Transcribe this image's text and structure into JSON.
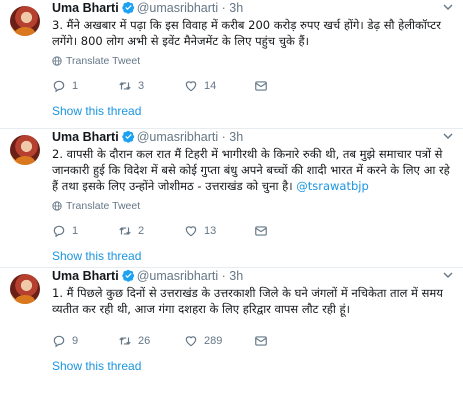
{
  "tweets": [
    {
      "name": "Uma Bharti",
      "handle": "@umasribharti",
      "dot": "·",
      "time": "3h",
      "text": "3. मैंने अखबार में पढ़ा कि इस विवाह में करीब 200 करोड़ रुपए खर्च होंगे। डेढ़ सौ हेलीकॉप्टर लगेंगे। 800 लोग अभी से इवेंट मैनेजमेंट के लिए पहुंच चुके हैं।",
      "mention": "",
      "translate": "Translate Tweet",
      "replies": "1",
      "retweets": "3",
      "likes": "14",
      "show_thread": "Show this thread"
    },
    {
      "name": "Uma Bharti",
      "handle": "@umasribharti",
      "dot": "·",
      "time": "3h",
      "text": "2. वापसी के दौरान कल रात मैं टिहरी में भागीरथी के किनारे रुकी थी, तब मुझे समाचार पत्रों से जानकारी हुई कि विदेश में बसे कोई गुप्ता बंधु अपने बच्चों की शादी भारत में करने के लिए आ रहे हैं तथा इसके लिए उन्होंने जोशीमठ - उत्तराखंड को चुना है।",
      "mention": "@tsrawatbjp",
      "translate": "Translate Tweet",
      "replies": "1",
      "retweets": "2",
      "likes": "13",
      "show_thread": "Show this thread"
    },
    {
      "name": "Uma Bharti",
      "handle": "@umasribharti",
      "dot": "·",
      "time": "3h",
      "text": "1. मैं पिछले कुछ दिनों से उत्तराखंड के उत्तरकाशी जिले के घने जंगलों में नचिकेता ताल में समय व्यतीत कर रही थी, आज गंगा दशहरा के लिए हरिद्वार वापस लौट रही हूं।",
      "mention": "",
      "translate": "",
      "replies": "9",
      "retweets": "26",
      "likes": "289",
      "show_thread": "Show this thread"
    }
  ],
  "colors": {
    "link": "#1b95e0",
    "muted": "#657786",
    "text": "#14171a",
    "divider": "#e6ecf0"
  },
  "icons": [
    "verified-icon",
    "chevron-down-icon",
    "globe-icon",
    "reply-icon",
    "retweet-icon",
    "like-icon",
    "message-icon"
  ]
}
